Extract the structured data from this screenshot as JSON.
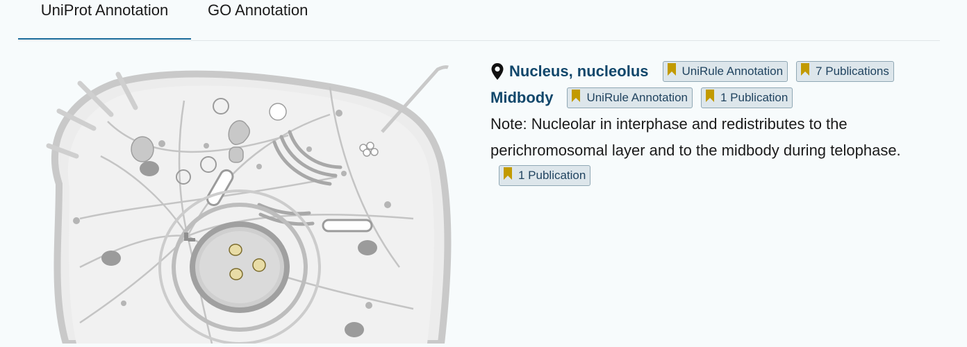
{
  "tabs": [
    {
      "label": "UniProt Annotation",
      "active": true
    },
    {
      "label": "GO Annotation",
      "active": false
    }
  ],
  "locations": [
    {
      "name": "Nucleus, nucleolus",
      "badges": [
        "UniRule Annotation",
        "7 Publications"
      ]
    },
    {
      "name": "Midbody",
      "badges": [
        "UniRule Annotation",
        "1 Publication"
      ]
    }
  ],
  "note": {
    "text": "Note: Nucleolar in interphase and redistributes to the perichromosomal layer and to the midbody during telophase.",
    "badge": "1 Publication"
  },
  "colors": {
    "tab_active_underline": "#1b6b9a",
    "location_title": "#11476b",
    "badge_bg": "#dde6eb",
    "bookmark": "#c29a00"
  },
  "icons": {
    "pin": "map-pin-icon",
    "bookmark": "bookmark-icon"
  }
}
